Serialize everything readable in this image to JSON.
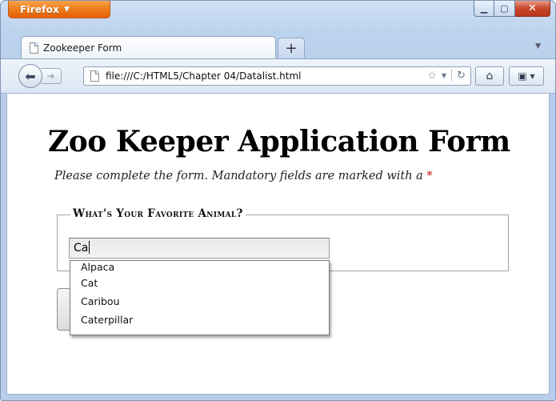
{
  "browser": {
    "menu_label": "Firefox",
    "tab_title": "Zookeeper Form",
    "new_tab_label": "+",
    "url": "file:///C:/HTML5/Chapter 04/Datalist.html"
  },
  "page": {
    "title": "Zoo Keeper Application Form",
    "instructions": "Please complete the form. Mandatory fields are marked with a",
    "mandatory_mark": "*",
    "fieldset_legend": "What's Your Favorite Animal?",
    "animal_input_value": "Ca",
    "suggestions": [
      "Alpaca",
      "Cat",
      "Caribou",
      "Caterpillar"
    ]
  },
  "icons": {
    "back": "back-arrow-icon",
    "forward": "forward-arrow-icon",
    "page": "page-icon",
    "star": "bookmark-star-icon",
    "reload": "reload-icon",
    "home": "home-icon",
    "bookmarks": "bookmarks-icon"
  },
  "colors": {
    "firefox_orange": "#ef7d1c",
    "mandatory_red": "#c41b1b"
  }
}
